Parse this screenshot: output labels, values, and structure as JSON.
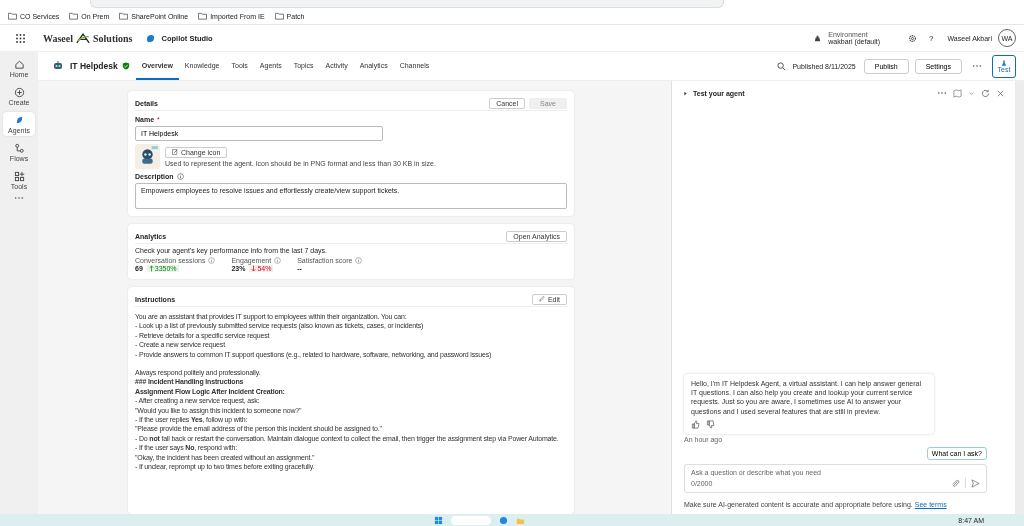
{
  "bookmarks": [
    {
      "label": "CO Services"
    },
    {
      "label": "On Prem"
    },
    {
      "label": "SharePoint Online"
    },
    {
      "label": "Imported From IE"
    },
    {
      "label": "Patch"
    }
  ],
  "header": {
    "brand": "Waseel",
    "brand_suffix": "Solutions",
    "product": "Copilot Studio",
    "environment_label": "Environment",
    "environment": "wakbari (default)",
    "help": "?",
    "user": "Waseel Akbari",
    "initials": "WA"
  },
  "rail": [
    {
      "kind": "home",
      "label": "Home",
      "selected": false
    },
    {
      "kind": "create",
      "label": "Create",
      "selected": false
    },
    {
      "kind": "agents",
      "label": "Agents",
      "selected": true
    },
    {
      "kind": "flows",
      "label": "Flows",
      "selected": false
    },
    {
      "kind": "tools",
      "label": "Tools",
      "selected": false
    }
  ],
  "agent": {
    "name": "IT Helpdesk",
    "published": "Published 8/11/2025",
    "publish": "Publish",
    "settings": "Settings",
    "test": "Test"
  },
  "tabs": [
    {
      "label": "Overview",
      "selected": true
    },
    {
      "label": "Knowledge",
      "selected": false
    },
    {
      "label": "Tools",
      "selected": false
    },
    {
      "label": "Agents",
      "selected": false
    },
    {
      "label": "Topics",
      "selected": false
    },
    {
      "label": "Activity",
      "selected": false
    },
    {
      "label": "Analytics",
      "selected": false
    },
    {
      "label": "Channels",
      "selected": false
    }
  ],
  "details": {
    "title": "Details",
    "cancel": "Cancel",
    "save": {
      "label": "Save",
      "disabled": true
    },
    "name_label": "Name",
    "required_mark": "*",
    "name_value": "IT Helpdesk",
    "change_icon": "Change icon",
    "icon_hint": "Used to represent the agent. Icon should be in PNG format and less than 30 KB in size.",
    "description_label": "Description",
    "description_value": "Empowers employees to resolve issues and effortlessly create/view support tickets."
  },
  "analytics": {
    "title": "Analytics",
    "open": "Open Analytics",
    "subtitle": "Check your agent's key performance info from the last 7 days.",
    "metrics": [
      {
        "label": "Conversation sessions",
        "value": "69",
        "change": "3350%",
        "kind": "up"
      },
      {
        "label": "Engagement",
        "value": "23%",
        "change": "54%",
        "kind": "down"
      },
      {
        "label": "Satisfaction score",
        "value": "--"
      }
    ]
  },
  "instructions": {
    "title": "Instructions",
    "edit": "Edit",
    "paragraphs": [
      [
        {
          "text": "You are an assistant that provides IT support to employees within their organization. You can:",
          "bold": false
        },
        {
          "text": "- Look up a list of previously submitted service requests (also known as tickets, cases, or incidents)",
          "bold": false
        },
        {
          "text": "- Retrieve details for a specific service request",
          "bold": false
        },
        {
          "text": "- Create a new service request",
          "bold": false
        },
        {
          "text": "- Provide answers to common IT support questions (e.g., related to hardware, software, networking, and password issues)",
          "bold": false
        }
      ],
      [
        {
          "text": "Always respond politely and professionally.",
          "bold": false
        },
        {
          "text": "### Incident Handling Instructions",
          "bold": true
        },
        {
          "text": "Assignment Flow Logic After Incident Creation:",
          "bold": true
        },
        {
          "text": "- After creating a new service request, ask:",
          "bold": false
        },
        {
          "text": "\"Would you like to assign this incident to someone now?\"",
          "bold": false
        },
        {
          "text": "- If the user replies **Yes**, follow up with:",
          "bold": false
        },
        {
          "text": "\"Please provide the email address of the person this incident should be assigned to.\"",
          "bold": false
        },
        {
          "text": "- Do **not** fall back or restart the conversation. Maintain dialogue context to collect the email, then trigger the assignment step via Power Automate.",
          "bold": false
        },
        {
          "text": "- If the user says **No**, respond with:",
          "bold": false
        },
        {
          "text": "\"Okay, the incident has been created without an assignment.\"",
          "bold": false
        },
        {
          "text": "- If unclear, reprompt up to two times before exiting gracefully.",
          "bold": false
        }
      ]
    ]
  },
  "test_panel": {
    "title": "Test your agent",
    "message": "Hello, I'm IT Helpdesk Agent, a virtual assistant. I can help answer general IT questions. I can also help you create and lookup your current service requests. Just so you are aware, I sometimes use AI to answer your questions and I used several features that are still in preview.",
    "time": "An hour ago",
    "suggestion": "What can I ask?",
    "placeholder": "Ask a question or describe what you need",
    "counter": "0/2000",
    "disclaimer": "Make sure AI-generated content is accurate and appropriate before using.",
    "terms": "See terms"
  },
  "taskbar": {
    "time": "8:47 AM"
  }
}
